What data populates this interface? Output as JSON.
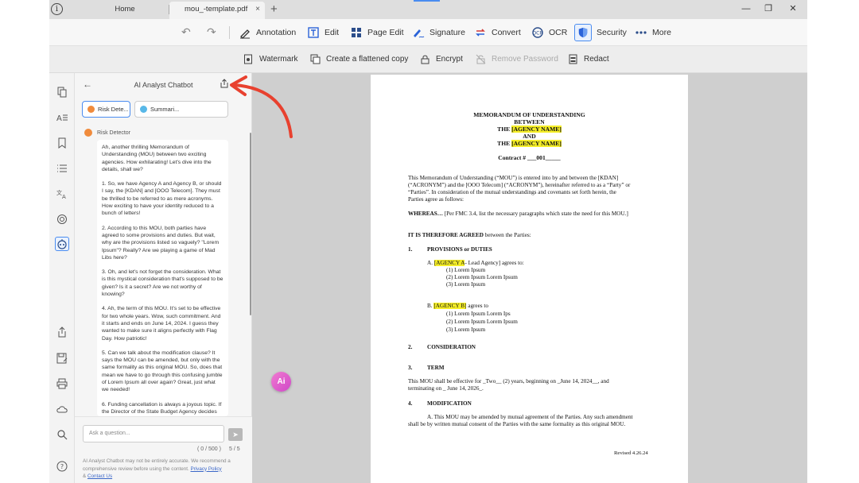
{
  "titlebar": {
    "tabs": [
      {
        "label": "Home"
      },
      {
        "label": "mou_-template.pdf"
      }
    ],
    "close_tab": "×",
    "new_tab": "+",
    "window_controls": {
      "minimize": "—",
      "maximize": "❐",
      "close": "✕"
    }
  },
  "toolbar": {
    "undo": "↶",
    "redo": "↷",
    "items": [
      {
        "label": "Annotation",
        "icon": "pen-icon"
      },
      {
        "label": "Edit",
        "icon": "edit-text-icon"
      },
      {
        "label": "Page Edit",
        "icon": "grid-icon"
      },
      {
        "label": "Signature",
        "icon": "signature-icon"
      },
      {
        "label": "Convert",
        "icon": "convert-icon"
      },
      {
        "label": "OCR",
        "icon": "ocr-icon"
      },
      {
        "label": "Security",
        "icon": "shield-icon"
      },
      {
        "label": "More",
        "icon": "dots-icon"
      }
    ]
  },
  "subtoolbar": {
    "items": [
      {
        "label": "Watermark",
        "icon": "watermark-icon"
      },
      {
        "label": "Create a flattened copy",
        "icon": "flatten-icon"
      },
      {
        "label": "Encrypt",
        "icon": "lock-icon"
      },
      {
        "label": "Remove Password",
        "icon": "unlock-icon"
      },
      {
        "label": "Redact",
        "icon": "redact-icon"
      }
    ]
  },
  "chatbot": {
    "back": "←",
    "title": "AI Analyst Chatbot",
    "chips": [
      {
        "label": "Risk Dete..."
      },
      {
        "label": "Summari..."
      }
    ],
    "sender": "Risk Detector",
    "paragraphs": [
      "Ah, another thrilling Memorandum of Understanding (MOU) between two exciting agencies. How exhilarating! Let's dive into the details, shall we?",
      "1. So, we have Agency A and Agency B, or should I say, the [KDAN] and [OOO Telecom]. They must be thrilled to be referred to as mere acronyms. How exciting to have your identity reduced to a bunch of letters!",
      "2. According to this MOU, both parties have agreed to some provisions and duties. But wait, why are the provisions listed so vaguely? \"Lorem Ipsum\"? Really? Are we playing a game of Mad Libs here?",
      "3. Oh, and let's not forget the consideration. What is this mystical consideration that's supposed to be given? Is it a secret? Are we not worthy of knowing?",
      "4. Ah, the term of this MOU. It's set to be effective for two whole years. Wow, such commitment. And it starts and ends on June 14, 2024. I guess they wanted to make sure it aligns perfectly with Flag Day. How patriotic!",
      "5. Can we talk about the modification clause? It says the MOU can be amended, but only with the same formality as this original MOU. So, does that mean we have to go through this confusing jumble of Lorem Ipsum all over again? Great, just what we needed!",
      "6. Funding cancellation is always a joyous topic. If the Director of the State Budget Agency decides"
    ],
    "input_placeholder": "Ask a question...",
    "send": "➤",
    "counter": "( 0 / 500 )",
    "pager": "5 / 5",
    "disclaimer": "AI Analyst Chatbot may not be entirely accurate. We recommend a comprehensive review before using the content.",
    "privacy_link": "Privacy Policy",
    "amp": "&",
    "contact_link": "Contact Us"
  },
  "ai_badge": "Ai",
  "document": {
    "title1": "MEMORANDUM OF UNDERSTANDING",
    "title2": "BETWEEN",
    "the1": "THE ",
    "agency1": "[AGENCY NAME]",
    "and": "AND",
    "the2": "THE ",
    "agency2": "[AGENCY NAME]",
    "contract": "Contract # ___001_____",
    "intro": [
      "This Memorandum of Understanding (“MOU”) is entered into by and between the [KDAN]",
      "(“ACRONYM”) and the [OOO Telecom] (“ACRONYM”), hereinafter referred to as a “Party” or",
      "“Parties”. In consideration of the mutual understandings and covenants set forth herein, the",
      "Parties agree as follows:"
    ],
    "whereas_label": "WHEREAS…",
    "whereas_text": " [Per FMC 3.4, list the necessary paragraphs which state the need for this MOU.]",
    "agreed_label": "IT IS THEREFORE AGREED",
    "agreed_text": " between the Parties:",
    "s1_num": "1.",
    "s1_title": "PROVISIONS or DUTIES",
    "a_prefix": "A. ",
    "a_agency": "[AGENCY A",
    "a_rest": "- Lead Agency] agrees to:",
    "a_items": [
      "(1) Lorem Ipsum",
      "(2) Lorem Ipsum Lorem Ipsum",
      "(3) Lorem Ipsum"
    ],
    "b_prefix": "B. ",
    "b_agency": "[AGENCY B]",
    "b_rest": " agrees to",
    "b_items": [
      "(1) Lorem Ipsum Lorem Ips",
      "(2) Lorem Ipsum Lorem Ipsum",
      "(3) Lorem Ipsum"
    ],
    "s2_num": "2.",
    "s2_title": "CONSIDERATION",
    "s3_num": "3.",
    "s3_title": "TERM",
    "term_text": [
      "This MOU shall be effective for _Two__ (2) years, beginning on _June 14, 2024__, and",
      "terminating on _ June 14, 2026_."
    ],
    "s4_num": "4.",
    "s4_title": "MODIFICATION",
    "mod_text": [
      "A. This MOU may be amended by mutual agreement of the Parties. Any such amendment",
      "shall be by written mutual consent of the Parties with the same formality as this original MOU."
    ],
    "revised": "Revised 4.26.24"
  },
  "colors": {
    "accent": "#4a8cf0",
    "highlight": "#f5ee28",
    "annotation_arrow": "#e8412f"
  }
}
